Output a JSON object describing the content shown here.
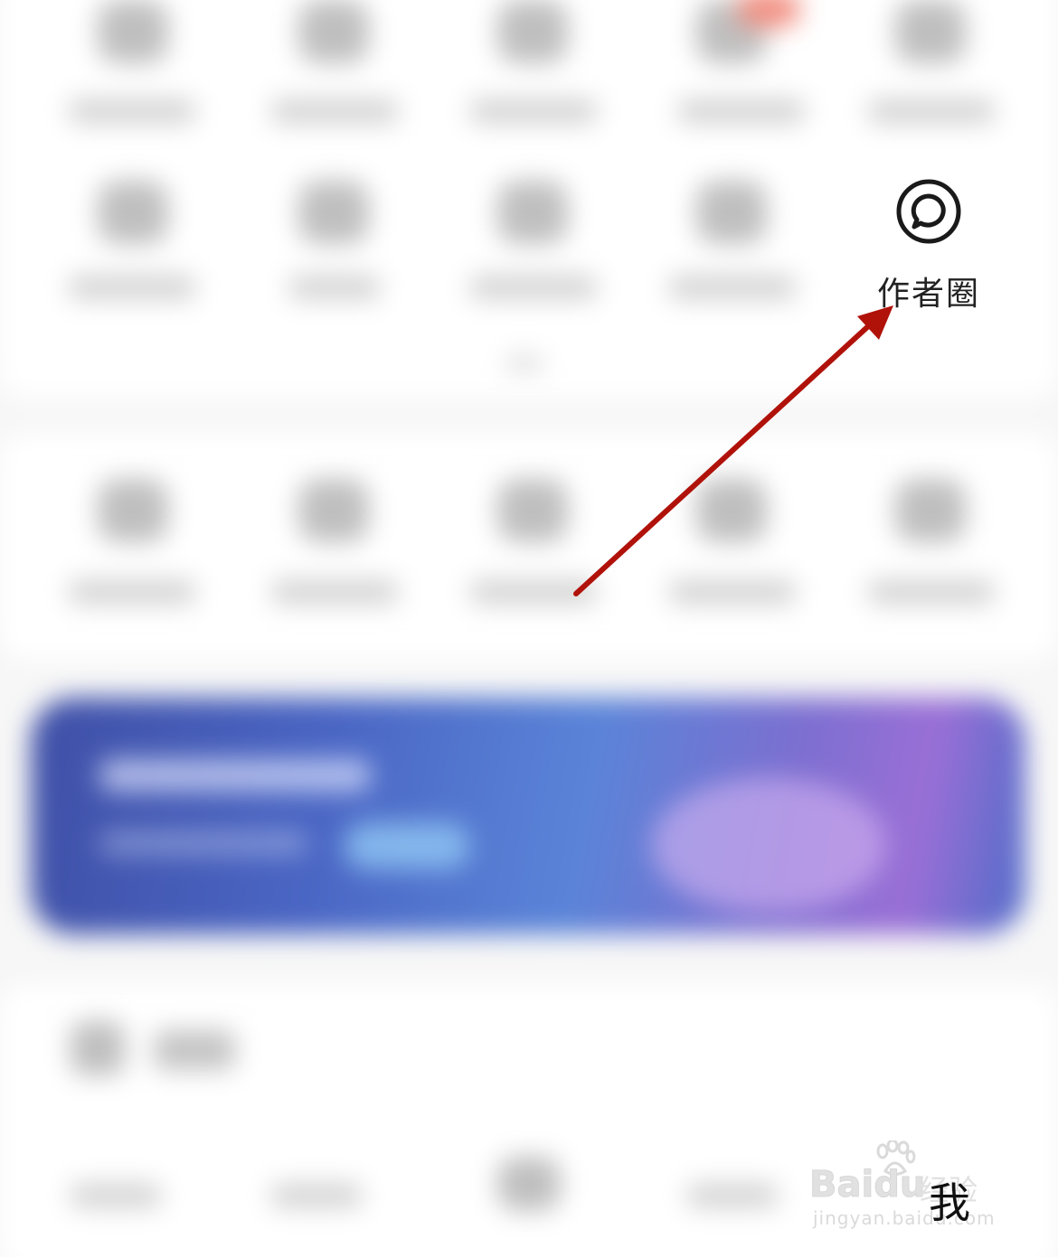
{
  "author_circle": {
    "label": "作者圈",
    "icon": "chat-bubble-circle-icon"
  },
  "bottom_nav": {
    "me_label": "我"
  },
  "watermark": {
    "text": "Baidu",
    "text_cn": "经验",
    "subtext": "jingyan.baidu.com"
  },
  "annotation": {
    "arrow_color": "#b0120a"
  },
  "colors": {
    "background": "#f7f7f7",
    "banner_start": "#3f4fa6",
    "banner_end": "#9a6fd6"
  }
}
